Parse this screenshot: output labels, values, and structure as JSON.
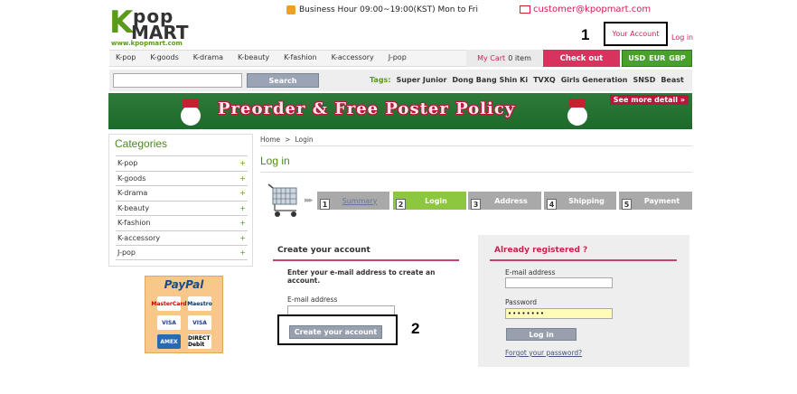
{
  "header": {
    "logo_top": "pop",
    "logo_k": "K",
    "logo_bottom": "MART",
    "logo_url": "www.kpopmart.com",
    "business_hours": "Business Hour 09:00~19:00(KST) Mon to Fri",
    "email": "customer@kpopmart.com",
    "your_account": "Your Account",
    "log_in": "Log in"
  },
  "annotations": {
    "label_1": "1",
    "label_2": "2"
  },
  "nav": {
    "items": [
      "K-pop",
      "K-goods",
      "K-drama",
      "K-beauty",
      "K-fashion",
      "K-accessory",
      "J-pop"
    ],
    "cart_label": "My Cart",
    "cart_count": "0 item",
    "checkout": "Check out",
    "currencies": [
      "USD",
      "EUR",
      "GBP"
    ]
  },
  "search": {
    "placeholder": "",
    "button": "Search",
    "tags_label": "Tags:",
    "tags": [
      "Super Junior",
      "Dong Bang Shin Ki",
      "TVXQ",
      "Girls Generation",
      "SNSD",
      "Beast"
    ]
  },
  "banner": {
    "text": "Preorder & Free Poster Policy",
    "see_more": "See more detail »"
  },
  "sidebar": {
    "title": "Categories",
    "items": [
      "K-pop",
      "K-goods",
      "K-drama",
      "K-beauty",
      "K-fashion",
      "K-accessory",
      "J-pop"
    ],
    "paypal_title": "PayPal",
    "cards": [
      "MasterCard",
      "Maestro",
      "VISA",
      "VISA",
      "AMEX",
      "DIRECT Debit"
    ]
  },
  "breadcrumb": {
    "home": "Home",
    "sep": ">",
    "current": "Login"
  },
  "page_title": "Log in",
  "steps": [
    {
      "num": "1",
      "label": "Summary"
    },
    {
      "num": "2",
      "label": "Login"
    },
    {
      "num": "3",
      "label": "Address"
    },
    {
      "num": "4",
      "label": "Shipping"
    },
    {
      "num": "5",
      "label": "Payment"
    }
  ],
  "create_account": {
    "title": "Create your account",
    "description": "Enter your e-mail address to create an account.",
    "email_label": "E-mail address",
    "email_value": "",
    "button": "Create your account"
  },
  "already_registered": {
    "title": "Already registered ?",
    "email_label": "E-mail address",
    "email_value": "",
    "password_label": "Password",
    "password_value": "••••••••",
    "button": "Log in",
    "forgot": "Forgot your password?"
  },
  "colors": {
    "brand_green": "#5a9a1a",
    "accent_pink": "#d8325f",
    "step_active": "#8dc63f"
  }
}
